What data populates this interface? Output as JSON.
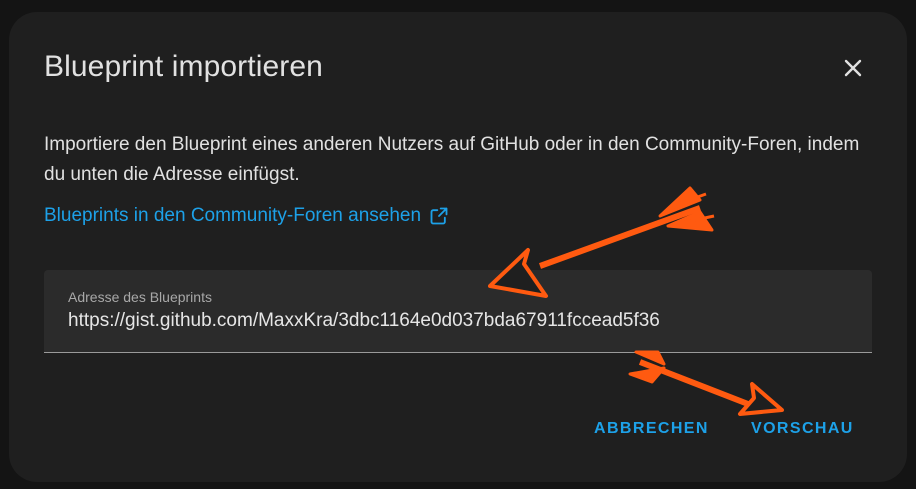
{
  "dialog": {
    "title": "Blueprint importieren",
    "close_icon": "close-icon",
    "description": "Importiere den Blueprint eines anderen Nutzers auf GitHub oder in den Community-Foren, indem du unten die Adresse einfügst.",
    "link_label": "Blueprints in den Community-Foren ansehen",
    "link_icon": "external-link-icon",
    "field": {
      "label": "Adresse des Blueprints",
      "value": "https://gist.github.com/MaxxKra/3dbc1164e0d037bda67911fccead5f36"
    },
    "actions": {
      "cancel_label": "ABBRECHEN",
      "preview_label": "VORSCHAU"
    }
  },
  "colors": {
    "accent": "#1da1e8",
    "annotation_arrow": "#ff5a10",
    "dialog_bg": "#1f1f1f"
  }
}
